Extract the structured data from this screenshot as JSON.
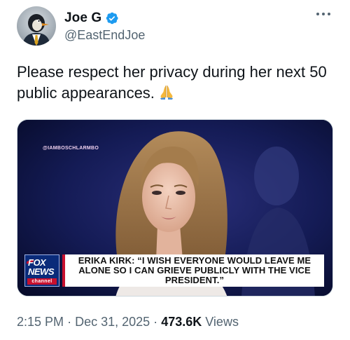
{
  "author": {
    "display_name": "Joe G",
    "handle": "@EastEndJoe",
    "verified": true,
    "avatar_icon": "penguin-in-suit-avatar"
  },
  "tweet": {
    "text": "Please respect her privacy during her next 50 public appearances.",
    "emoji": "folded-hands-emoji"
  },
  "media": {
    "watermark": "@IAMBOSCHLARMBO",
    "network_logo": {
      "line1": "FOX",
      "line2": "NEWS",
      "line3": "channel"
    },
    "chyron": "ERIKA KIRK: “I WISH EVERYONE WOULD LEAVE ME ALONE SO I CAN GRIEVE PUBLICLY WITH THE VICE PRESIDENT.”"
  },
  "meta": {
    "time": "2:15 PM",
    "separator": "·",
    "date": "Dec 31, 2025",
    "views_count": "473.6K",
    "views_label": "Views"
  },
  "colors": {
    "text_primary": "#0f1419",
    "text_secondary": "#536471",
    "verified_blue": "#1d9bf0",
    "fox_blue": "#0a2b7a",
    "fox_red": "#c8102e"
  }
}
